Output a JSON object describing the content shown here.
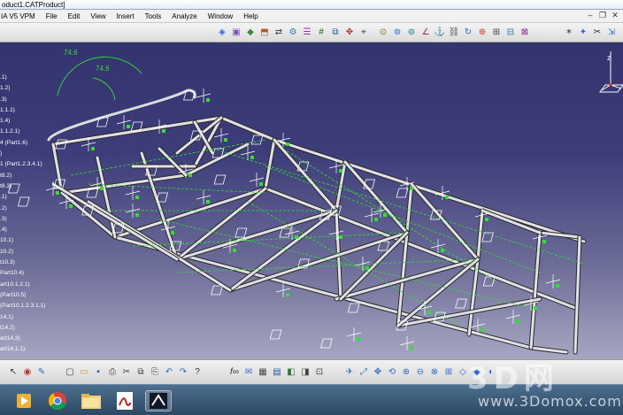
{
  "window": {
    "title": "oduct1.CATProduct]"
  },
  "menubar": {
    "app_label": "IA V5 VPM",
    "items": [
      "File",
      "Edit",
      "View",
      "Insert",
      "Tools",
      "Analyze",
      "Window",
      "Help"
    ]
  },
  "tree": {
    "items": [
      ".1)",
      "1.2)",
      ".3)",
      "1.1.1)",
      "1.4)",
      "1.1.2.1)",
      "4 (Part1.6)",
      ")",
      "1 (Part1.2.3.4.1)",
      "t8.2)",
      "t8.3)",
      ".1)",
      ".2)",
      ".3)",
      ".4)",
      "10.1)",
      "10.2)",
      "t10.3)",
      "Part10.4)",
      "art10.1.2.1)",
      "(Part10.5)",
      "(Part10.1.2.3.1.1)",
      "14.1)",
      "t14.2)",
      "art14.3)",
      "art14.1.1)"
    ]
  },
  "dimensions": {
    "d1": "74.6",
    "d2": "74.6"
  },
  "taskbar": {
    "apps": [
      "media-player",
      "chrome",
      "file-explorer",
      "pdf-reader",
      "catia"
    ]
  },
  "watermark": {
    "chars": "3D网",
    "url": "www.3Domox.com"
  }
}
